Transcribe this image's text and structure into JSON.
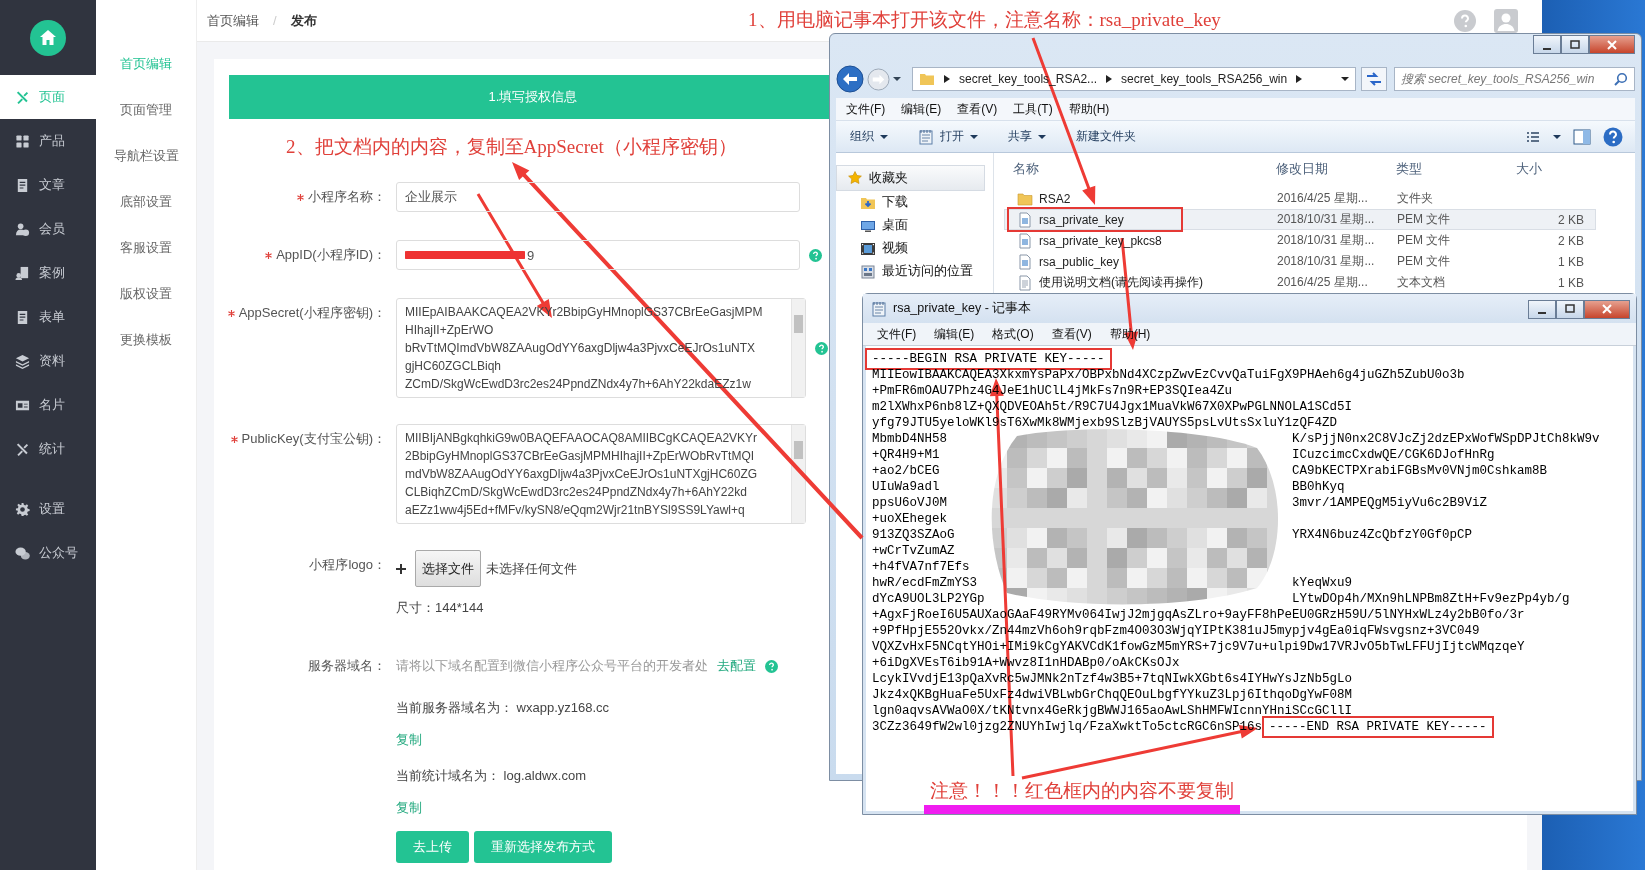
{
  "sidebar": {
    "groups": [
      [
        {
          "label": "页面",
          "selected": true
        },
        {
          "label": "产品",
          "selected": false
        },
        {
          "label": "文章",
          "selected": false
        },
        {
          "label": "会员",
          "selected": false
        },
        {
          "label": "案例",
          "selected": false
        },
        {
          "label": "表单",
          "selected": false
        },
        {
          "label": "资料",
          "selected": false
        },
        {
          "label": "名片",
          "selected": false
        },
        {
          "label": "统计",
          "selected": false
        }
      ],
      [
        {
          "label": "设置",
          "selected": false
        },
        {
          "label": "公众号",
          "selected": false
        }
      ]
    ]
  },
  "subnav": {
    "items": [
      {
        "label": "首页编辑",
        "selected": true
      },
      {
        "label": "页面管理",
        "selected": false
      },
      {
        "label": "导航栏设置",
        "selected": false
      },
      {
        "label": "底部设置",
        "selected": false
      },
      {
        "label": "客服设置",
        "selected": false
      },
      {
        "label": "版权设置",
        "selected": false
      },
      {
        "label": "更换模板",
        "selected": false
      }
    ]
  },
  "breadcrumb": {
    "items": [
      "首页编辑",
      "发布"
    ],
    "separator": "/"
  },
  "form": {
    "step_title": "1.填写授权信息",
    "fields": [
      {
        "kind": "input",
        "label": "小程序名称：",
        "required": true,
        "value": "企业展示"
      },
      {
        "kind": "input",
        "label": "AppID(小程序ID)：",
        "required": true,
        "value": "9",
        "redacted": true,
        "help": true
      },
      {
        "kind": "textarea",
        "label": "AppSecret(小程序密钥)：",
        "required": true,
        "help": true,
        "lines": [
          "MIIEpAIBAAKCAQEA2VKYr2BbipGyHMnoplGS37CBrEeGasjMPM",
          "HIhajII+ZpErWO",
          "bRvTtMQImdVbW8ZAAugOdYY6axgDljw4a3PjvxCeEJrOs1uNTX",
          "gjHC60ZGCLBiqh",
          "ZCmD/SkgWcEwdD3rc2es24PpndZNdx4y7h+6AhY22kdaEZz1w"
        ]
      },
      {
        "kind": "textarea",
        "label": "PublicKey(支付宝公钥)：",
        "required": true,
        "lines": [
          "MIIBIjANBgkqhkiG9w0BAQEFAAOCAQ8AMIIBCgKCAQEA2VKYr",
          "2BbipGyHMnoplGS37CBrEeGasjMPMHIhajII+ZpErWObRvTtMQI",
          "mdVbW8ZAAugOdYY6axgDljw4a3PjvxCeEJrOs1uNTXgjHC60ZG",
          "CLBiqhZCmD/SkgWcEwdD3rc2es24PpndZNdx4y7h+6AhY22kd",
          "aEZz1ww4j5Ed+fMFv/kySN8/eQqm2Wjr21tnBYSl9SS9LYawl+q"
        ]
      },
      {
        "kind": "file",
        "label": "小程序logo：",
        "button": "选择文件",
        "status": "未选择任何文件",
        "note": "尺寸：144*144"
      },
      {
        "kind": "domains",
        "label": "服务器域名：",
        "hint": "请将以下域名配置到微信小程序公众号平台的开发者处",
        "link": "去配置",
        "help": true,
        "entries": [
          {
            "text": "当前服务器域名为： wxapp.yz168.cc",
            "action": "复制"
          },
          {
            "text": "当前统计域名为： log.aldwx.com",
            "action": "复制"
          }
        ]
      }
    ],
    "buttons": [
      "去上传",
      "重新选择发布方式"
    ]
  },
  "explorer": {
    "address": [
      "secret_key_tools_RSA2...",
      "secret_key_tools_RSA256_win"
    ],
    "search": {
      "placeholder": "搜索 secret_key_tools_RSA256_win"
    },
    "menu": [
      "文件(F)",
      "编辑(E)",
      "查看(V)",
      "工具(T)",
      "帮助(H)"
    ],
    "toolbar": [
      {
        "label": "组织",
        "dropdown": true
      },
      {
        "label": "打开",
        "dropdown": true
      },
      {
        "label": "共享",
        "dropdown": true
      },
      {
        "label": "新建文件夹",
        "dropdown": false
      }
    ],
    "nav": [
      {
        "label": "收藏夹",
        "children": [
          {
            "label": "下载"
          },
          {
            "label": "桌面"
          },
          {
            "label": "视频"
          },
          {
            "label": "最近访问的位置"
          }
        ]
      }
    ],
    "columns": [
      "名称",
      "修改日期",
      "类型",
      "大小"
    ],
    "rows": [
      {
        "kind": "folder",
        "name": "RSA2",
        "date": "2016/4/25 星期...",
        "type": "文件夹",
        "selected": false,
        "framed": false
      },
      {
        "kind": "file",
        "name": "rsa_private_key",
        "date": "2018/10/31 星期...",
        "type": "PEM 文件",
        "size": "2 KB",
        "selected": true,
        "framed": true
      },
      {
        "kind": "file",
        "name": "rsa_private_key_pkcs8",
        "date": "2018/10/31 星期...",
        "type": "PEM 文件",
        "size": "2 KB",
        "selected": false,
        "framed": false
      },
      {
        "kind": "file",
        "name": "rsa_public_key",
        "date": "2018/10/31 星期...",
        "type": "PEM 文件",
        "size": "1 KB",
        "selected": false,
        "framed": false
      },
      {
        "kind": "text",
        "name": "使用说明文档(请先阅读再操作)",
        "date": "2016/4/25 星期...",
        "type": "文本文档",
        "size": "1 KB",
        "selected": false,
        "framed": false
      }
    ]
  },
  "notepad": {
    "title": "rsa_private_key - 记事本",
    "menu": [
      "文件(F)",
      "编辑(E)",
      "格式(O)",
      "查看(V)",
      "帮助(H)"
    ],
    "lines": [
      {
        "text": "-----BEGIN RSA PRIVATE KEY-----",
        "framed": true
      },
      {
        "text": "MIIEowIBAAKCAQEA3XkxmYsPaPx/OBPxbNd4XCzpZwvEzCvvQaTuiFgX9PHAeh6g4juGZh5ZubU0o3b"
      },
      {
        "text": "+PmFR6mOAU7Phz4G4JeE1hUClL4jMkFs7n9R+EP3SQIea4Zu"
      },
      {
        "text": "m2lXWhxP6nb8lZ+QXQDVEOAh5t/R9C7U4Jgx1MuaVkW67X0XPwPGLNNOLA1SCd5I"
      },
      {
        "text": "yfg79JTU5yeloWKl9sT6XwMk8WMjexb9SlzBjVAUYS5psLvUtsSxluY1zQF4ZD"
      },
      {
        "text": "MbmbD4NH58",
        "after_blur": "K/sPjjN0nx2C8VJcZj2dzEPxWofWSpDPJtCh8kW9v"
      },
      {
        "text": "+QR4H9+M1",
        "after_blur": "ICuzcimcCxdwQE/CGK6DJofHnRg"
      },
      {
        "text": "+ao2/bCEG",
        "after_blur": "CA9bKECTPXrabiFGBsMv0VNjm0Cshkam8B"
      },
      {
        "text": "UIuWa9adl",
        "after_blur": "BB0hKyq"
      },
      {
        "text": "ppsU6oVJ0M",
        "after_blur": "3mvr/1AMPEQgM5iyVu6c2B9ViZ"
      },
      {
        "text": "+uoXEhegek"
      },
      {
        "text": "913ZQ3SZAoG",
        "after_blur": "YRX4N6buz4ZcQbfzY0Gf0pCP"
      },
      {
        "text": "+wCrTvZumAZ"
      },
      {
        "text": "+h4fVA7nf7Efs"
      },
      {
        "text": "hwR/ecdFmZmYS3",
        "after_blur": "kYeqWxu9"
      },
      {
        "text": "dYcA9UOL3LP2YGp",
        "after_blur": "LYtwDOp4h/MXn9hLNPBm8ZtH+Fv9ezPp4yb/g"
      },
      {
        "text": "+AgxFjRoeI6U5AUXaoGAaF49RYMv064IwjJ2mjgqAsZLro+9ayFF8hPeEU0GRzH59U/5lNYHxWLz4y2bB0fo/3r"
      },
      {
        "text": "+9PfHpjE552Ovkx/Zn44mzVh6oh9rqbFzm4O03O3WjqYIPtK381uJ5mypjv4gEa0iqFWsvgsnz+3VC049"
      },
      {
        "text": "VQXZvHxF5NCqtYHOi+IMi9kCgYAKVCdK1fowGzM5mYRS+7jc9V7u+ulpi9Dw17VRJvO5bTwLFFUjIjtcWMqzqeY"
      },
      {
        "text": "+6iDgXVEsT6ib91A+Wwvz8I1nHDABp0/oAkCKsOJx"
      },
      {
        "text": "LcykIVvdjE13pQaXvRc5wJMNk2nTzf4w3B5+7tqNIwkXGbt6s4IYHwYsJzNb5gLo"
      },
      {
        "text": "Jkz4xQKBgHuaFe5UxFz4dwiVBLwbGrChqQEOuLbgfYYkuZ3Lpj6IthqoDgYwF08M"
      },
      {
        "text": "lgn0aqvsAVWaO0X/tKNtvnx4GeRkjgBWWJ165aoAwLShHMFWIcnnYHniSCcGCllI"
      },
      {
        "text": "3CZz3649fW2wl0jzg2ZNUYhIwjlq/FzaXwktTo5ctcRGC6nSP16s",
        "framed_tail": "-----END RSA PRIVATE KEY-----"
      }
    ]
  },
  "annotations": [
    {
      "text": "1、用电脑记事本打开该文件，注意名称：rsa_private_key"
    },
    {
      "text": "2、把文档内的内容，复制至AppSecret（小程序密钥）"
    },
    {
      "text": "注意！！！红色框内的内容不要复制",
      "underlined": true
    }
  ]
}
